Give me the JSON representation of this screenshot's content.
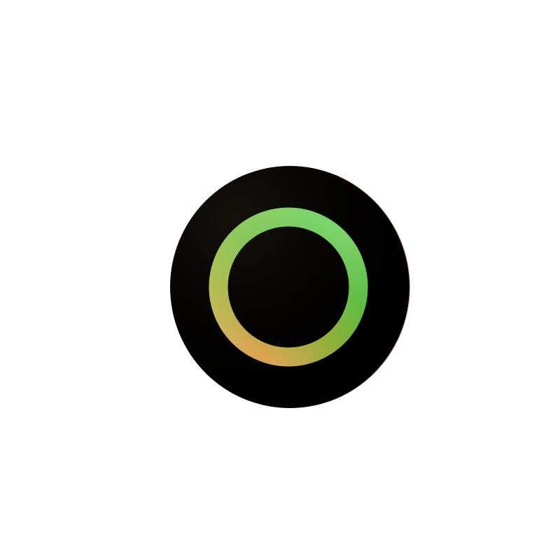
{
  "app_icon": {
    "name": "circle-ring-icon",
    "colors": {
      "page_background": "#ffffff",
      "disc": "#000000",
      "ring_top": "#7cd56a",
      "ring_right": "#5ab83c",
      "ring_bottom_right": "#9bac2c",
      "ring_bottom_left": "#d6a550",
      "ring_left": "#a9c96a"
    }
  }
}
